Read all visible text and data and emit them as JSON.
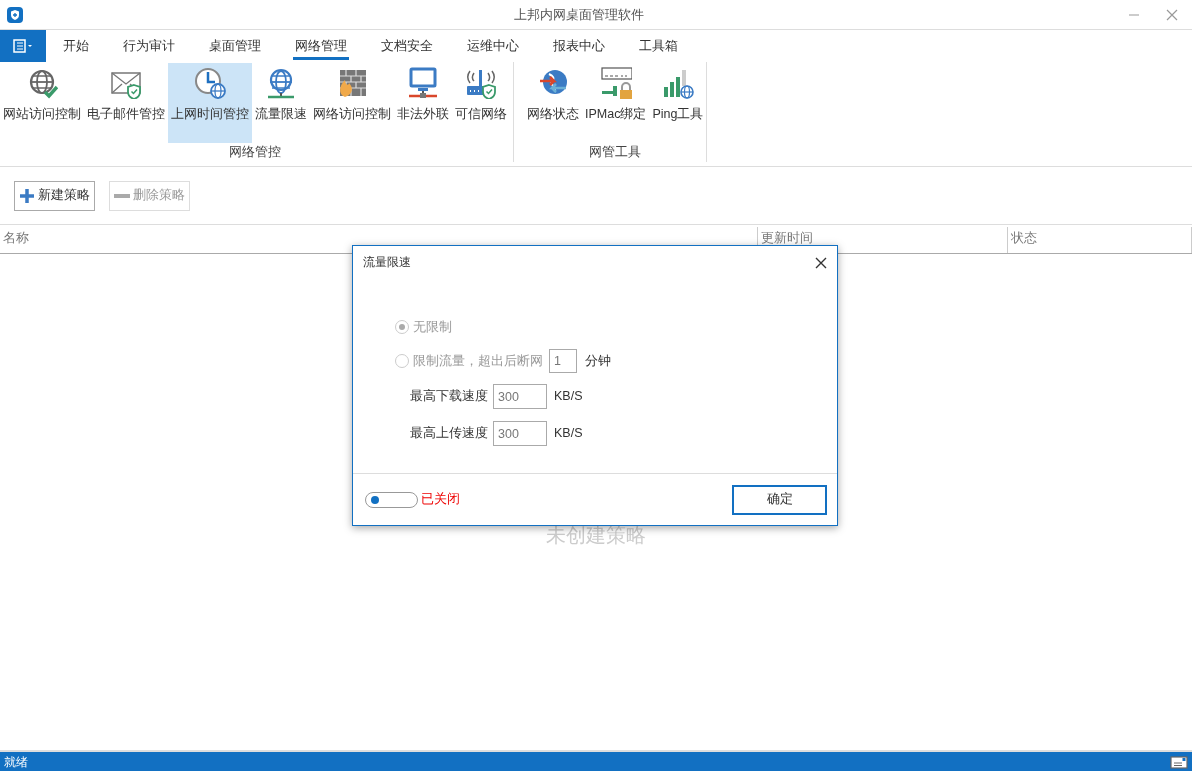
{
  "window": {
    "title": "上邦内网桌面管理软件"
  },
  "tabs": [
    {
      "label": "开始",
      "selected": false
    },
    {
      "label": "行为审计",
      "selected": false
    },
    {
      "label": "桌面管理",
      "selected": false
    },
    {
      "label": "网络管理",
      "selected": true
    },
    {
      "label": "文档安全",
      "selected": false
    },
    {
      "label": "运维中心",
      "selected": false
    },
    {
      "label": "报表中心",
      "selected": false
    },
    {
      "label": "工具箱",
      "selected": false
    }
  ],
  "ribbon_groups": [
    {
      "label": "网络管控",
      "items": [
        {
          "label": "网站访问控制",
          "kind": "website",
          "selected": false
        },
        {
          "label": "电子邮件管控",
          "kind": "email",
          "selected": false
        },
        {
          "label": "上网时间管控",
          "kind": "schedule",
          "selected": true
        },
        {
          "label": "流量限速",
          "kind": "bandwidth",
          "selected": false
        },
        {
          "label": "网络访问控制",
          "kind": "firewall",
          "selected": false
        },
        {
          "label": "非法外联",
          "kind": "lan",
          "selected": false
        },
        {
          "label": "可信网络",
          "kind": "router",
          "selected": false
        }
      ]
    },
    {
      "label": "网管工具",
      "items": [
        {
          "label": "网络状态",
          "kind": "status",
          "selected": false
        },
        {
          "label": "IPMac绑定",
          "kind": "binding",
          "selected": false
        },
        {
          "label": "Ping工具",
          "kind": "ping",
          "selected": false
        }
      ]
    }
  ],
  "toolbar": [
    {
      "label": "新建策略",
      "kind": "add",
      "disabled": false
    },
    {
      "label": "删除策略",
      "kind": "remove",
      "disabled": true
    }
  ],
  "table": {
    "columns": [
      "名称",
      "更新时间",
      "状态"
    ],
    "empty_text": "未创建策略"
  },
  "dialog": {
    "title": "流量限速",
    "options": [
      {
        "label": "无限制",
        "selected": true,
        "disabled": true
      },
      {
        "label": "限制流量，超出后断网",
        "selected": false,
        "disabled": true,
        "value": "1",
        "unit": "分钟"
      }
    ],
    "fields": [
      {
        "label": "最高下载速度",
        "value": "300",
        "unit": "KB/S"
      },
      {
        "label": "最高上传速度",
        "value": "300",
        "unit": "KB/S"
      }
    ],
    "toggle": {
      "on": false,
      "label": "已关闭"
    },
    "button": "确定"
  },
  "status_bar": {
    "text": "就绪"
  }
}
